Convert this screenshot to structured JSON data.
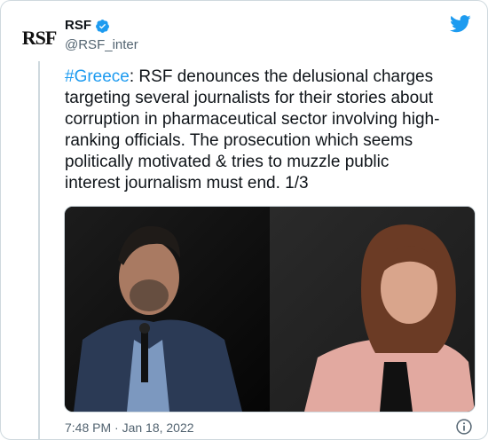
{
  "tweet": {
    "author": {
      "avatar_text": "RSF",
      "display_name": "RSF",
      "handle": "@RSF_inter",
      "verified": true
    },
    "hashtag": "#Greece",
    "body": ": RSF denounces the delusional charges\ntargeting several journalists for their stories about\ncorruption in pharmaceutical sector involving high-\nranking officials. The prosecution which seems\npolitically motivated & tries to muzzle public\ninterest journalism must end. 1/3",
    "timestamp": "7:48 PM · Jan 18, 2022"
  },
  "colors": {
    "link": "#1d9bf0",
    "text": "#0f1419",
    "secondary": "#536471",
    "border": "#cfd9de"
  },
  "icons": {
    "brand": "twitter-bird-icon",
    "verified": "verified-badge-icon",
    "info": "info-icon"
  }
}
